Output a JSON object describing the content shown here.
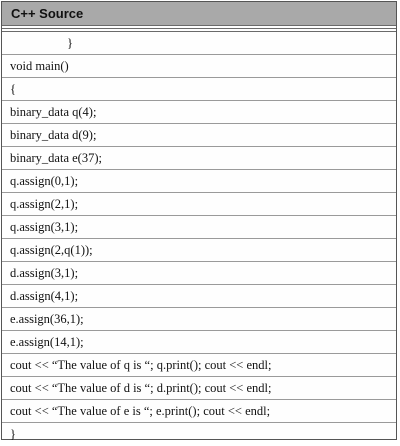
{
  "header": {
    "title": "C++ Source"
  },
  "code": {
    "lines": [
      "}",
      "void main()",
      "{",
      "binary_data q(4);",
      "binary_data d(9);",
      "binary_data e(37);",
      "q.assign(0,1);",
      "q.assign(2,1);",
      "q.assign(3,1);",
      "q.assign(2,q(1));",
      "d.assign(3,1);",
      "d.assign(4,1);",
      "e.assign(36,1);",
      "e.assign(14,1);",
      "cout << “The value of q is “; q.print(); cout << endl;",
      "cout << “The value of d is “; d.print(); cout << endl;",
      "cout << “The value of e is “; e.print(); cout << endl;",
      "}"
    ]
  }
}
